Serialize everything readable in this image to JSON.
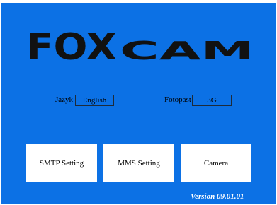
{
  "app": {
    "logo_text": "FOXCAM",
    "version": "Version 09.01.01"
  },
  "language": {
    "label": "Jazyk",
    "value": "English"
  },
  "trapcam": {
    "label": "Fotopast",
    "value": "3G"
  },
  "buttons": {
    "smtp": "SMTP Setting",
    "mms": "MMS Setting",
    "camera": "Camera"
  },
  "colors": {
    "background": "#0c71e5",
    "logo": "#111111",
    "button": "#ffffff"
  }
}
